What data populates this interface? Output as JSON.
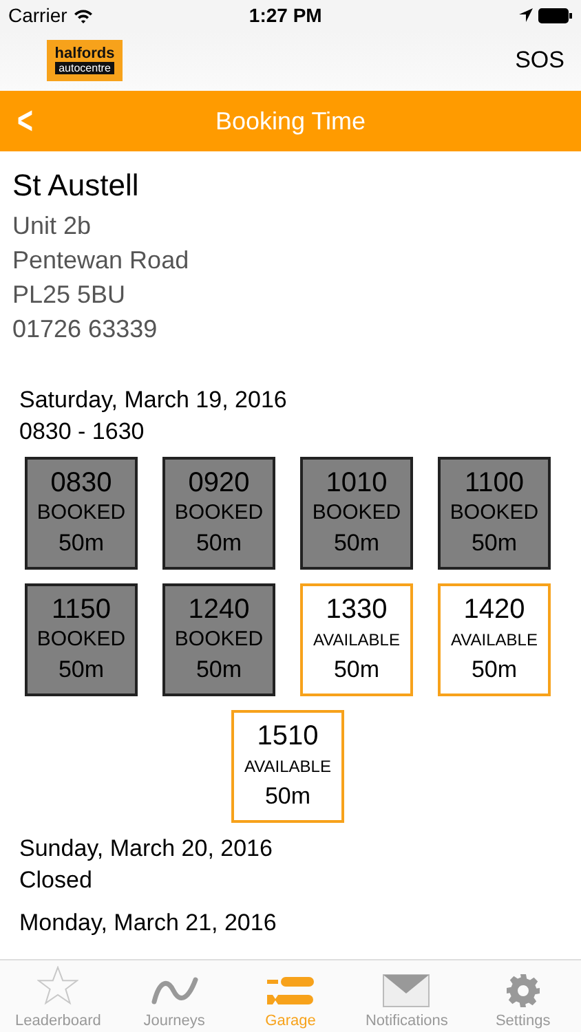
{
  "status_bar": {
    "carrier": "Carrier",
    "time": "1:27 PM"
  },
  "header": {
    "logo": {
      "line_1": "halfords",
      "line_2": "autocentre"
    },
    "sos": "SOS"
  },
  "nav_bar": {
    "back": "<",
    "title": "Booking Time"
  },
  "garage": {
    "name": "St Austell",
    "address": [
      "Unit 2b",
      "Pentewan Road",
      "PL25 5BU"
    ],
    "phone": "01726 63339"
  },
  "days": [
    {
      "date": "Saturday, March 19, 2016",
      "hours": "0830 - 1630",
      "slots": [
        {
          "time": "0830",
          "status": "BOOKED",
          "booked": true,
          "duration": "50m"
        },
        {
          "time": "0920",
          "status": "BOOKED",
          "booked": true,
          "duration": "50m"
        },
        {
          "time": "1010",
          "status": "BOOKED",
          "booked": true,
          "duration": "50m"
        },
        {
          "time": "1100",
          "status": "BOOKED",
          "booked": true,
          "duration": "50m"
        },
        {
          "time": "1150",
          "status": "BOOKED",
          "booked": true,
          "duration": "50m"
        },
        {
          "time": "1240",
          "status": "BOOKED",
          "booked": true,
          "duration": "50m"
        },
        {
          "time": "1330",
          "status": "AVAILABLE",
          "booked": false,
          "duration": "50m"
        },
        {
          "time": "1420",
          "status": "AVAILABLE",
          "booked": false,
          "duration": "50m"
        },
        {
          "time": "1510",
          "status": "AVAILABLE",
          "booked": false,
          "duration": "50m"
        }
      ]
    },
    {
      "date": "Sunday, March 20, 2016",
      "hours": "Closed"
    },
    {
      "date": "Monday, March 21, 2016"
    }
  ],
  "tab_bar": [
    {
      "label": "Leaderboard",
      "kind": "star",
      "selected": false
    },
    {
      "label": "Journeys",
      "kind": "wave",
      "selected": false
    },
    {
      "label": "Garage",
      "kind": "wrench",
      "selected": true
    },
    {
      "label": "Notifications",
      "kind": "mail",
      "selected": false
    },
    {
      "label": "Settings",
      "kind": "gear",
      "selected": false
    }
  ]
}
